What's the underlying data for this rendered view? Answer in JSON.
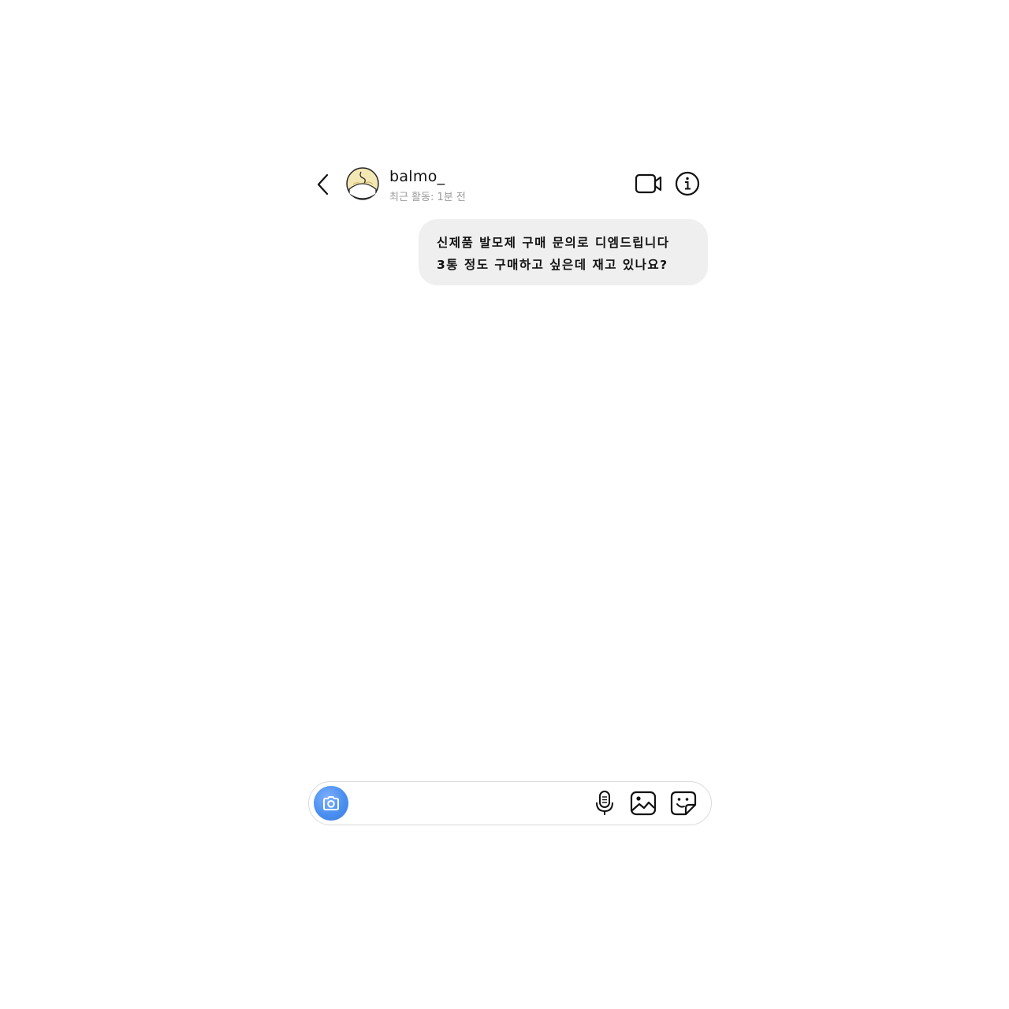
{
  "header": {
    "username": "balmo_",
    "status": "최근 활동: 1분 전"
  },
  "messages": [
    {
      "direction": "outgoing",
      "lines": [
        "신제품 발모제 구매 문의로 디엠드립니다",
        "3통 정도 구매하고 싶은데 재고 있나요?"
      ]
    }
  ],
  "composer": {
    "placeholder": "",
    "value": "",
    "camera_color": "#4a8ff0"
  },
  "icons": {
    "back": "chevron-left-icon",
    "video": "video-camera-icon",
    "info": "info-icon",
    "camera": "camera-icon",
    "mic": "microphone-icon",
    "gallery": "image-icon",
    "sticker": "sticker-icon"
  }
}
